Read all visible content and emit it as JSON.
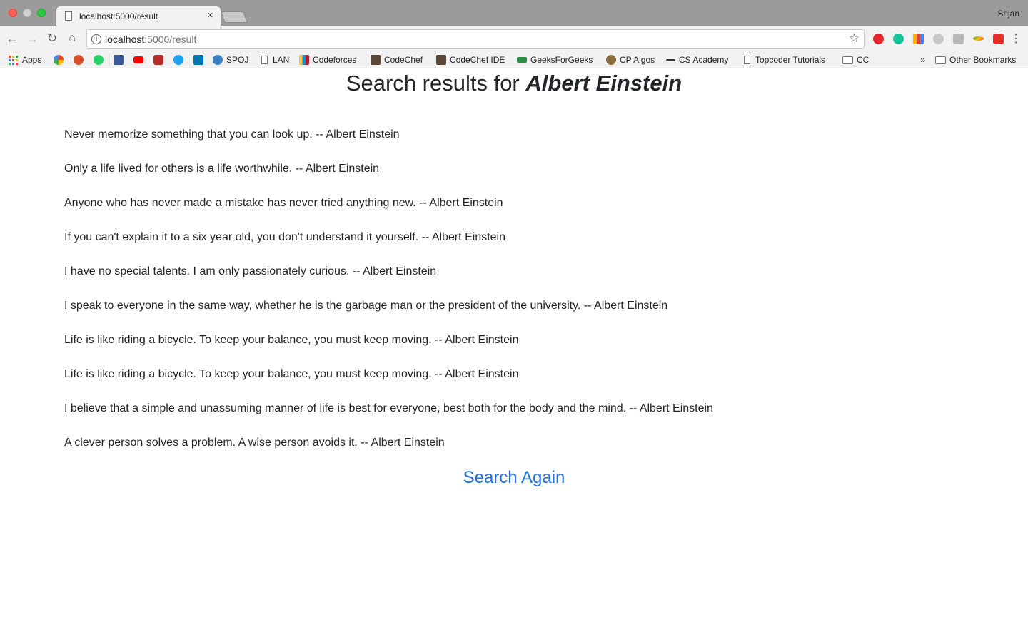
{
  "browser": {
    "tab_title": "localhost:5000/result",
    "profile_name": "Srijan",
    "url_host": "localhost",
    "url_path": ":5000/result"
  },
  "bookmarks": {
    "apps": "Apps",
    "spoj": "SPOJ",
    "lan": "LAN",
    "codeforces": "Codeforces",
    "codechef": "CodeChef",
    "codechef_ide": "CodeChef IDE",
    "geeksforgeeks": "GeeksForGeeks",
    "cp_algos": "CP Algos",
    "cs_academy": "CS Academy",
    "topcoder": "Topcoder Tutorials",
    "cc": "CC",
    "other": "Other Bookmarks",
    "overflow_chevron": "»"
  },
  "page": {
    "heading_prefix": "Search results for",
    "query": "Albert Einstein",
    "quotes": [
      "Never memorize something that you can look up. -- Albert Einstein",
      "Only a life lived for others is a life worthwhile. -- Albert Einstein",
      "Anyone who has never made a mistake has never tried anything new. -- Albert Einstein",
      "If you can't explain it to a six year old, you don't understand it yourself. -- Albert Einstein",
      "I have no special talents. I am only passionately curious. -- Albert Einstein",
      "I speak to everyone in the same way, whether he is the garbage man or the president of the university. -- Albert Einstein",
      "Life is like riding a bicycle. To keep your balance, you must keep moving. -- Albert Einstein",
      "Life is like riding a bicycle. To keep your balance, you must keep moving. -- Albert Einstein",
      "I believe that a simple and unassuming manner of life is best for everyone, best both for the body and the mind. -- Albert Einstein",
      "A clever person solves a problem. A wise person avoids it. -- Albert Einstein"
    ],
    "search_again": "Search Again"
  },
  "colors": {
    "link": "#1a73e8",
    "text": "#212529",
    "tabstrip": "#9b9b9b",
    "toolbar": "#f2f2f2"
  }
}
